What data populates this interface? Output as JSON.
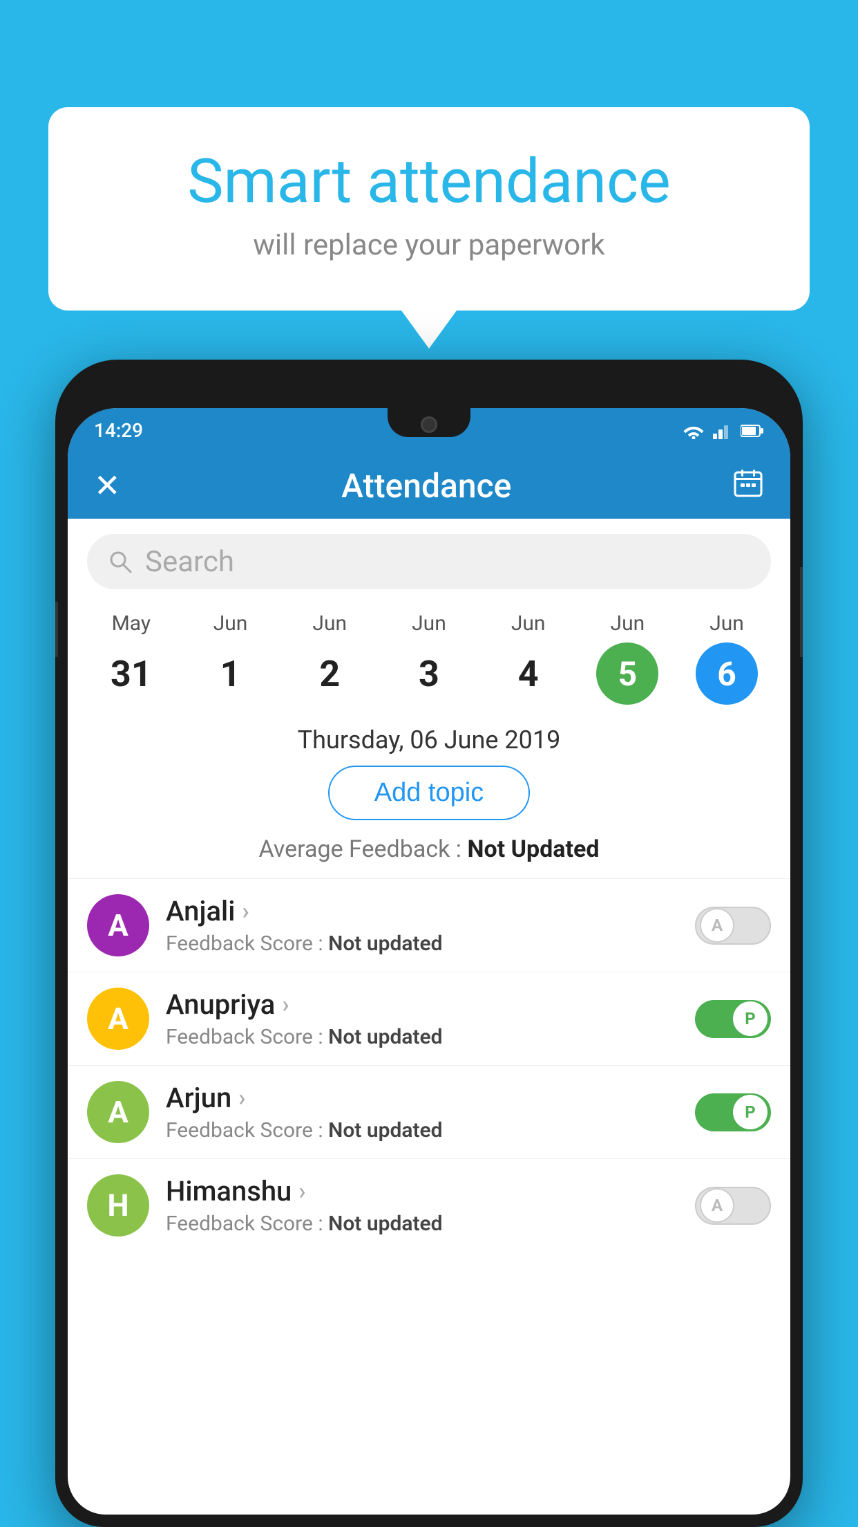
{
  "background_color": "#29b6e8",
  "speech_bubble": {
    "title": "Smart attendance",
    "subtitle": "will replace your paperwork"
  },
  "status_bar": {
    "time": "14:29",
    "icons": [
      "wifi",
      "signal",
      "battery"
    ]
  },
  "app_header": {
    "title": "Attendance",
    "close_label": "×",
    "calendar_icon": "📅"
  },
  "search": {
    "placeholder": "Search"
  },
  "calendar": {
    "days": [
      {
        "month": "May",
        "date": "31",
        "style": "normal"
      },
      {
        "month": "Jun",
        "date": "1",
        "style": "normal"
      },
      {
        "month": "Jun",
        "date": "2",
        "style": "normal"
      },
      {
        "month": "Jun",
        "date": "3",
        "style": "normal"
      },
      {
        "month": "Jun",
        "date": "4",
        "style": "normal"
      },
      {
        "month": "Jun",
        "date": "5",
        "style": "green"
      },
      {
        "month": "Jun",
        "date": "6",
        "style": "blue"
      }
    ]
  },
  "selected_date": "Thursday, 06 June 2019",
  "add_topic_label": "Add topic",
  "average_feedback": {
    "label": "Average Feedback : ",
    "value": "Not Updated"
  },
  "students": [
    {
      "name": "Anjali",
      "avatar_letter": "A",
      "avatar_color": "#9c27b0",
      "feedback_label": "Feedback Score : ",
      "feedback_value": "Not updated",
      "toggle_state": "off",
      "toggle_label": "A"
    },
    {
      "name": "Anupriya",
      "avatar_letter": "A",
      "avatar_color": "#ffc107",
      "feedback_label": "Feedback Score : ",
      "feedback_value": "Not updated",
      "toggle_state": "on",
      "toggle_label": "P"
    },
    {
      "name": "Arjun",
      "avatar_letter": "A",
      "avatar_color": "#8bc34a",
      "feedback_label": "Feedback Score : ",
      "feedback_value": "Not updated",
      "toggle_state": "on",
      "toggle_label": "P"
    },
    {
      "name": "Himanshu",
      "avatar_letter": "H",
      "avatar_color": "#8bc34a",
      "feedback_label": "Feedback Score : ",
      "feedback_value": "Not updated",
      "toggle_state": "off",
      "toggle_label": "A"
    }
  ]
}
